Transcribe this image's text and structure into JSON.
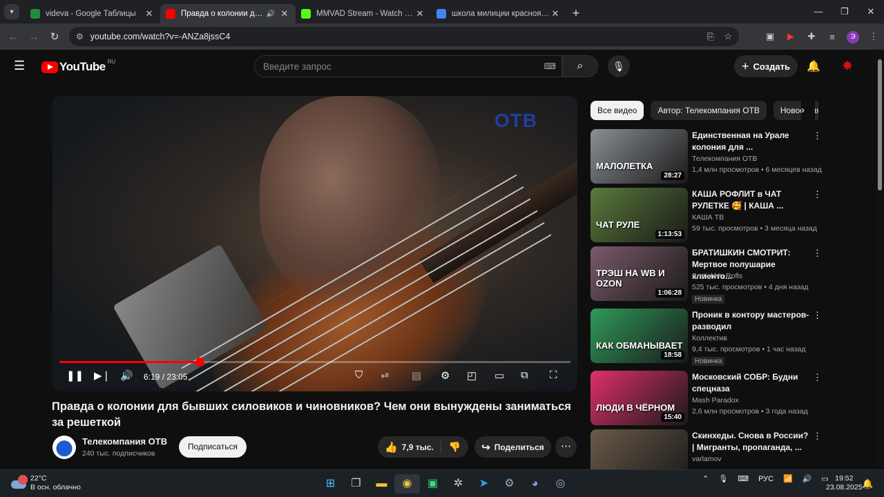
{
  "browser": {
    "tabs": [
      {
        "title": "videva - Google Таблицы",
        "color": "#1e8e3e",
        "active": false
      },
      {
        "title": "Правда о колонии для бывших силовиков",
        "color": "#ff0000",
        "active": true
      },
      {
        "title": "MMVAD Stream - Watch Live on Kick",
        "color": "#53fc18",
        "active": false
      },
      {
        "title": "школа милиции красноярск - Поиск в Google",
        "color": "#4285f4",
        "active": false
      }
    ],
    "url": "youtube.com/watch?v=-ANZa8jssC4",
    "profile_initial": "Э"
  },
  "youtube": {
    "logo_text": "YouTube",
    "region": "RU",
    "search_placeholder": "Введите запрос",
    "create_label": "Создать"
  },
  "player": {
    "watermark": "ОТВ",
    "time": "6:19 / 23:05",
    "progress_fraction": 0.274
  },
  "video": {
    "title": "Правда о колонии для бывших силовиков и чиновников? Чем они вынуждены заниматься за решеткой",
    "channel": "Телекомпания ОТВ",
    "subscribers": "240 тыс. подписчиков",
    "subscribe_label": "Подписаться",
    "likes": "7,9 тыс.",
    "share_label": "Поделиться"
  },
  "sidebar": {
    "chips": [
      "Все видео",
      "Автор: Телекомпания ОТВ",
      "Новое для вас"
    ],
    "recommendations": [
      {
        "title": "Единственная на Урале колония для ...",
        "channel": "Телекомпания ОТВ",
        "meta": "1,4 млн просмотров • 6 месяцев назад",
        "duration": "28:27",
        "caption": "МАЛОЛЕТКА",
        "badge": "",
        "bg": "#8a8f95"
      },
      {
        "title": "КАША РОФЛИТ в ЧАТ РУЛЕТКЕ 🥰 | КАША ...",
        "channel": "КАША ТВ",
        "meta": "59 тыс. просмотров • 3 месяца назад",
        "duration": "1:13:53",
        "caption": "ЧАТ РУЛЕ",
        "badge": "",
        "bg": "#5a7a3a"
      },
      {
        "title": "БРАТИШКИН СМОТРИТ: Мертвое полушарие клиенто...",
        "channel": "Bratishkin Rofls",
        "meta": "525 тыс. просмотров • 4 дня назад",
        "duration": "1:06:28",
        "caption": "ТРЭШ НА WB И OZON",
        "badge": "Новинка",
        "bg": "#7a5a6a"
      },
      {
        "title": "Проник в контору мастеров-разводил",
        "channel": "Коллектив",
        "meta": "9,4 тыс. просмотров • 1 час назад",
        "duration": "18:58",
        "caption": "КАК ОБМАНЫВАЕТ",
        "badge": "Новинка",
        "bg": "#2f9a5a"
      },
      {
        "title": "Московский СОБР: Будни спецназа",
        "channel": "Mash Paradox",
        "meta": "2,6 млн просмотров • 3 года назад",
        "duration": "15:40",
        "caption": "ЛЮДИ В ЧЁРНОМ",
        "badge": "",
        "bg": "#e0306a"
      },
      {
        "title": "Скинхеды. Снова в России? | Мигранты, пропаганда, ...",
        "channel": "varlamov",
        "meta": "",
        "duration": "",
        "caption": "",
        "badge": "",
        "bg": "#6a5a4a"
      }
    ]
  },
  "taskbar": {
    "weather_temp": "22°C",
    "weather_desc": "В осн. облачно",
    "weather_alerts": "4",
    "language": "РУС",
    "time": "19:52",
    "date": "23.08.2025"
  }
}
